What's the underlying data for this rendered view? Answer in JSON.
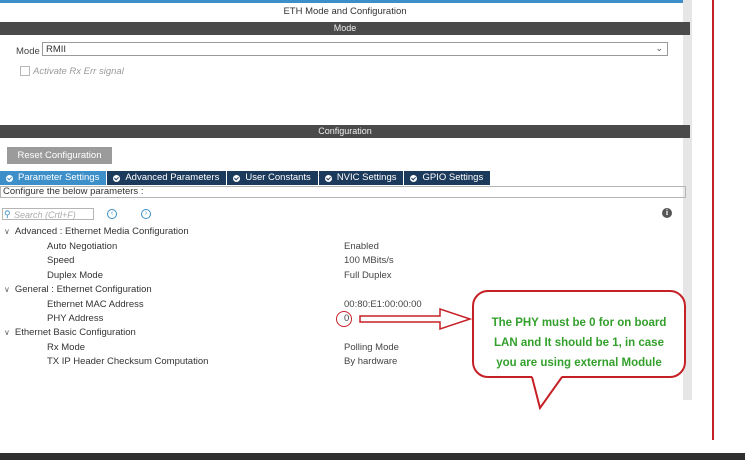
{
  "window": {
    "title": "ETH Mode and Configuration"
  },
  "mode_section": {
    "header": "Mode",
    "mode_label": "Mode",
    "mode_value": "RMII",
    "rx_err_label": "Activate Rx Err signal",
    "rx_err_checked": false
  },
  "config_section": {
    "header": "Configuration",
    "reset_button": "Reset Configuration",
    "tabs": [
      {
        "label": "Parameter Settings",
        "active": true
      },
      {
        "label": "Advanced Parameters",
        "active": false
      },
      {
        "label": "User Constants",
        "active": false
      },
      {
        "label": "NVIC Settings",
        "active": false
      },
      {
        "label": "GPIO Settings",
        "active": false
      }
    ],
    "instructions": "Configure the below parameters :",
    "search_placeholder": "Search (Crtl+F)",
    "groups": [
      {
        "name": "Advanced : Ethernet Media Configuration",
        "params": [
          {
            "name": "Auto Negotiation",
            "value": "Enabled"
          },
          {
            "name": "Speed",
            "value": "100 MBits/s"
          },
          {
            "name": "Duplex Mode",
            "value": "Full Duplex"
          }
        ]
      },
      {
        "name": "General : Ethernet Configuration",
        "params": [
          {
            "name": "Ethernet MAC Address",
            "value": "00:80:E1:00:00:00"
          },
          {
            "name": "PHY Address",
            "value": "0"
          }
        ]
      },
      {
        "name": "Ethernet Basic Configuration",
        "params": [
          {
            "name": "Rx Mode",
            "value": "Polling Mode"
          },
          {
            "name": "TX IP Header Checksum Computation",
            "value": "By hardware"
          }
        ]
      }
    ]
  },
  "annotation": {
    "callout_lines": [
      "The PHY must be 0 for on board",
      "LAN and It should be 1, in case",
      "you are using external Module"
    ],
    "text_color": "#33a02c",
    "border_color": "#c52026"
  },
  "icons": {
    "search": "search-icon",
    "prev": "previous-icon",
    "next": "next-icon",
    "info": "info-icon",
    "dropdown": "chevron-down-icon"
  }
}
